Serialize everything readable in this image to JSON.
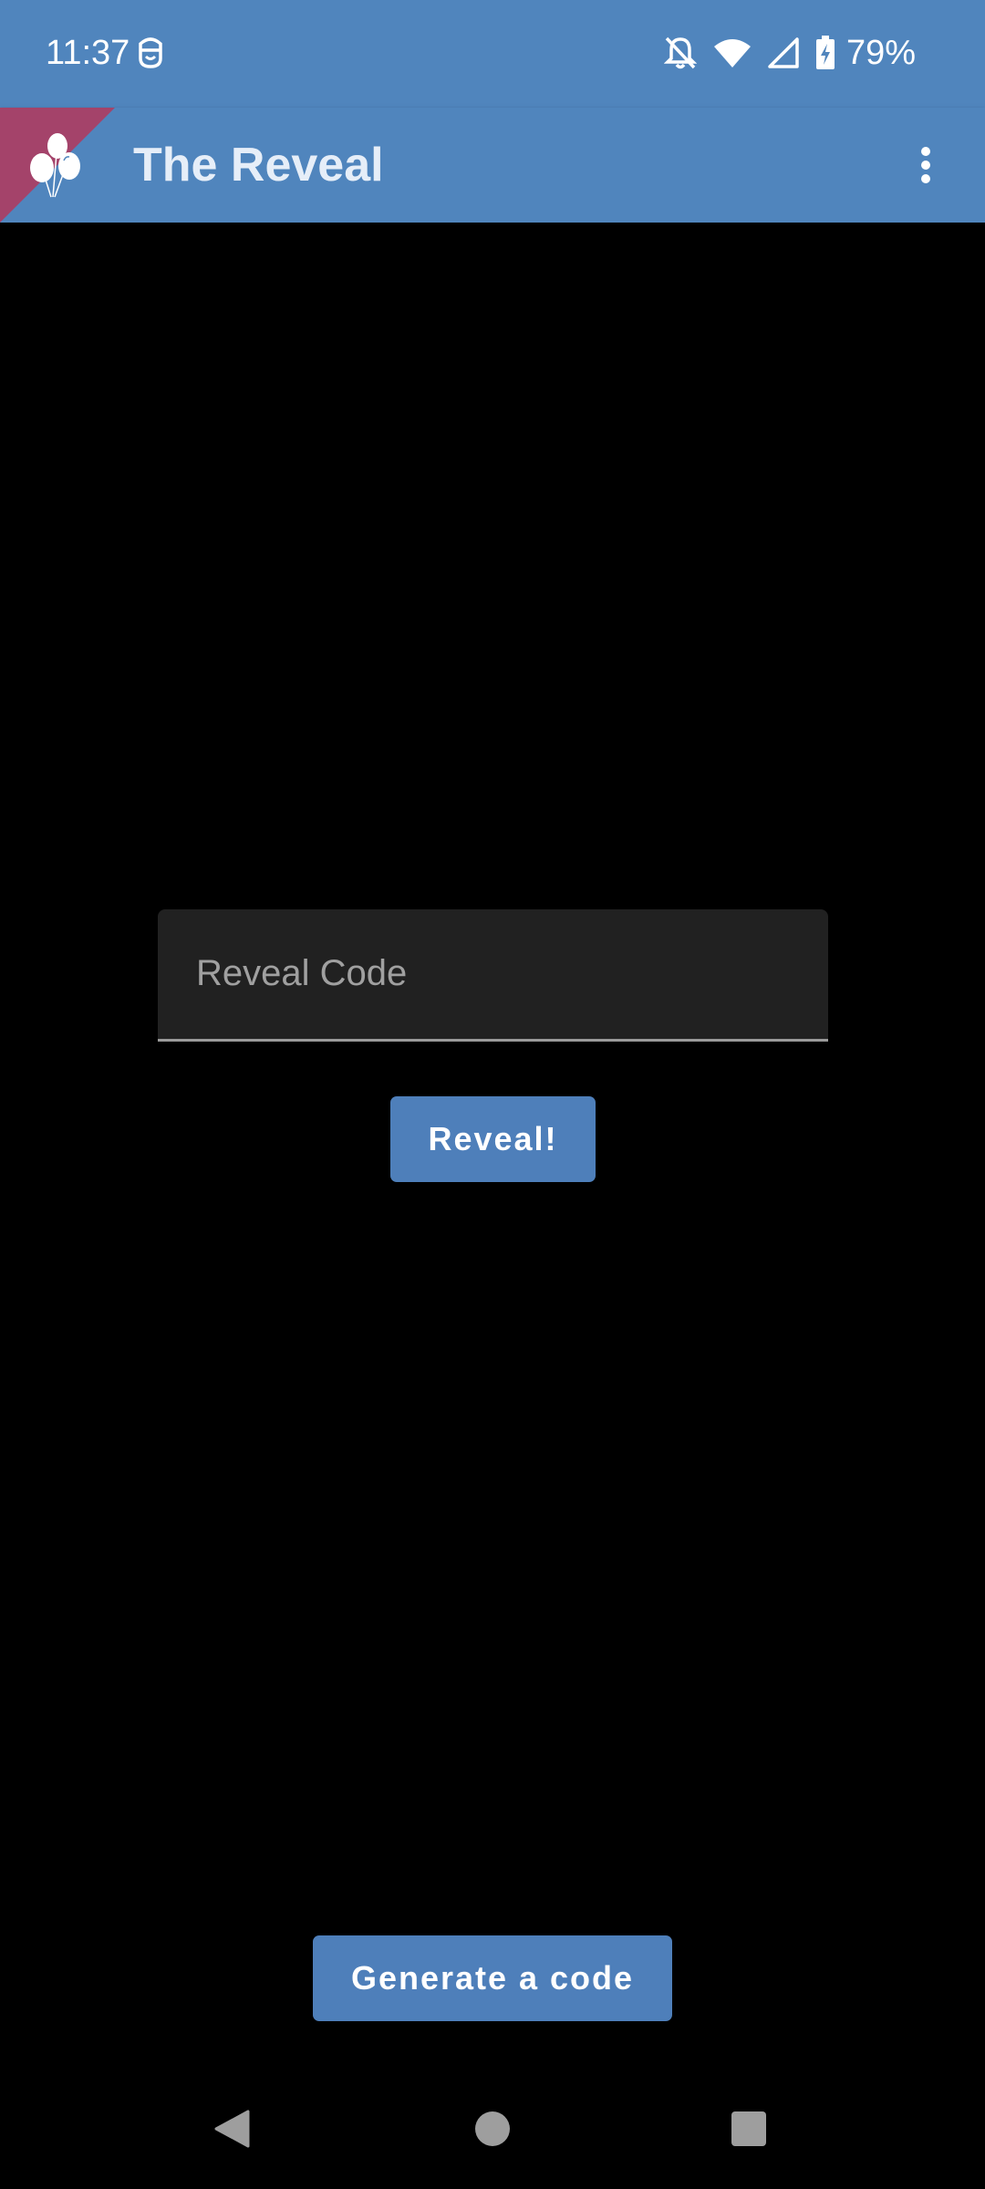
{
  "status_bar": {
    "time": "11:37",
    "battery": "79%",
    "icons": [
      "face-icon",
      "bell-off-icon",
      "wifi-icon",
      "cell-signal-icon",
      "battery-charging-icon"
    ]
  },
  "app_bar": {
    "title": "The Reveal",
    "logo_icon": "balloons-icon",
    "menu_icon": "more-vert-icon"
  },
  "reveal_form": {
    "code_placeholder": "Reveal Code",
    "code_value": "",
    "reveal_button_label": "Reveal!"
  },
  "generate_button_label": "Generate a code",
  "navigation": {
    "icons": [
      "back-icon",
      "home-icon",
      "recents-icon"
    ]
  },
  "colors": {
    "primary": "#5085bd",
    "button": "#4e7fba",
    "logo_accent": "#a4436a",
    "background": "#000000",
    "field_background": "#212121"
  }
}
